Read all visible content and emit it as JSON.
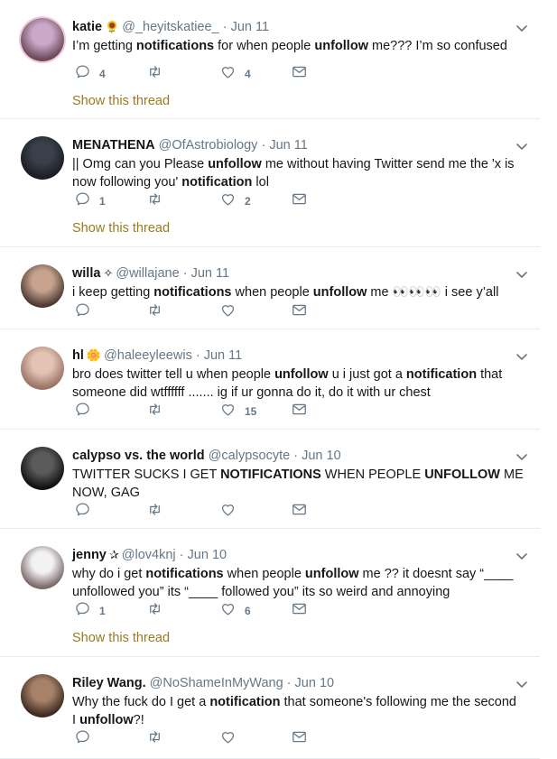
{
  "show_thread_label": "Show this thread",
  "tweets": [
    {
      "name": "katie",
      "badge": "🌻",
      "handle": "@_heyitskatiee_",
      "sep": "·",
      "time": "Jun 11",
      "body": [
        [
          "I’m getting ",
          0
        ],
        [
          "notifications",
          1
        ],
        [
          " for when people ",
          0
        ],
        [
          "unfollow",
          1
        ],
        [
          " me??? I’m so confused",
          0
        ]
      ],
      "replies": "4",
      "retweets": "",
      "likes": "4",
      "show_thread": true
    },
    {
      "name": "MENATHENA",
      "badge": "",
      "handle": "@OfAstrobiology",
      "sep": "·",
      "time": "Jun 11",
      "body": [
        [
          "|| Omg can you Please ",
          0
        ],
        [
          "unfollow",
          1
        ],
        [
          " me without having Twitter send me the 'x is now following you' ",
          0
        ],
        [
          "notification",
          1
        ],
        [
          " lol",
          0
        ]
      ],
      "replies": "1",
      "retweets": "",
      "likes": "2",
      "show_thread": true
    },
    {
      "name": "willa",
      "badge": "✧",
      "handle": "@willajane",
      "sep": "·",
      "time": "Jun 11",
      "body": [
        [
          "i keep getting ",
          0
        ],
        [
          "notifications",
          1
        ],
        [
          " when people ",
          0
        ],
        [
          "unfollow",
          1
        ],
        [
          " me 👀👀👀 i see y’all",
          0
        ]
      ],
      "replies": "",
      "retweets": "",
      "likes": "",
      "show_thread": false
    },
    {
      "name": "hl",
      "badge": "🌼",
      "handle": "@haleeyleewis",
      "sep": "·",
      "time": "Jun 11",
      "body": [
        [
          "bro does twitter tell u when people ",
          0
        ],
        [
          "unfollow",
          1
        ],
        [
          " u i just got a ",
          0
        ],
        [
          "notification",
          1
        ],
        [
          " that someone did wtffffff ....... ig if ur gonna do it, do it with ur chest",
          0
        ]
      ],
      "replies": "",
      "retweets": "",
      "likes": "15",
      "show_thread": false
    },
    {
      "name": "calypso vs. the world",
      "badge": "",
      "handle": "@calypsocyte",
      "sep": "·",
      "time": "Jun 10",
      "body": [
        [
          "TWITTER SUCKS I GET ",
          0
        ],
        [
          "NOTIFICATIONS",
          1
        ],
        [
          " WHEN PEOPLE ",
          0
        ],
        [
          "UNFOLLOW",
          1
        ],
        [
          " ME NOW, GAG",
          0
        ]
      ],
      "replies": "",
      "retweets": "",
      "likes": "",
      "show_thread": false
    },
    {
      "name": "jenny",
      "badge": "✰",
      "handle": "@lov4knj",
      "sep": "·",
      "time": "Jun 10",
      "body": [
        [
          "why do i get ",
          0
        ],
        [
          "notifications",
          1
        ],
        [
          " when people ",
          0
        ],
        [
          "unfollow",
          1
        ],
        [
          " me ?? it doesnt say “____ unfollowed you” its “____ followed you” its so weird and annoying",
          0
        ]
      ],
      "replies": "1",
      "retweets": "",
      "likes": "6",
      "show_thread": true
    },
    {
      "name": "Riley Wang.",
      "badge": "",
      "handle": "@NoShameInMyWang",
      "sep": "·",
      "time": "Jun 10",
      "body": [
        [
          "Why the fuck do I get a ",
          0
        ],
        [
          "notification",
          1
        ],
        [
          " that someone's following me the second I ",
          0
        ],
        [
          "unfollow",
          1
        ],
        [
          "?!",
          0
        ]
      ],
      "replies": "",
      "retweets": "",
      "likes": "",
      "show_thread": false
    }
  ],
  "colors": {
    "text": "#14171a",
    "muted": "#657786",
    "thread_link": "#9b7a1f",
    "divider": "#e6ecf0"
  },
  "icons": {
    "reply": "reply-icon",
    "retweet": "retweet-icon",
    "like": "heart-icon",
    "dm": "envelope-icon",
    "menu": "chevron-down-icon"
  }
}
